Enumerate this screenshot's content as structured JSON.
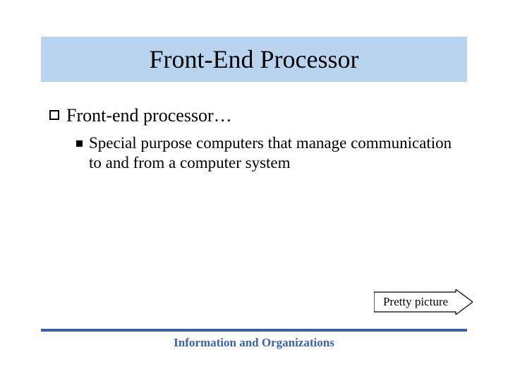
{
  "slide": {
    "title": "Front-End Processor",
    "bullets": [
      {
        "text": "Front-end processor…",
        "children": [
          {
            "text": "Special purpose computers that manage communication to and from a computer system"
          }
        ]
      }
    ],
    "action_button": {
      "label": "Pretty picture"
    },
    "footer": "Information and Organizations"
  }
}
